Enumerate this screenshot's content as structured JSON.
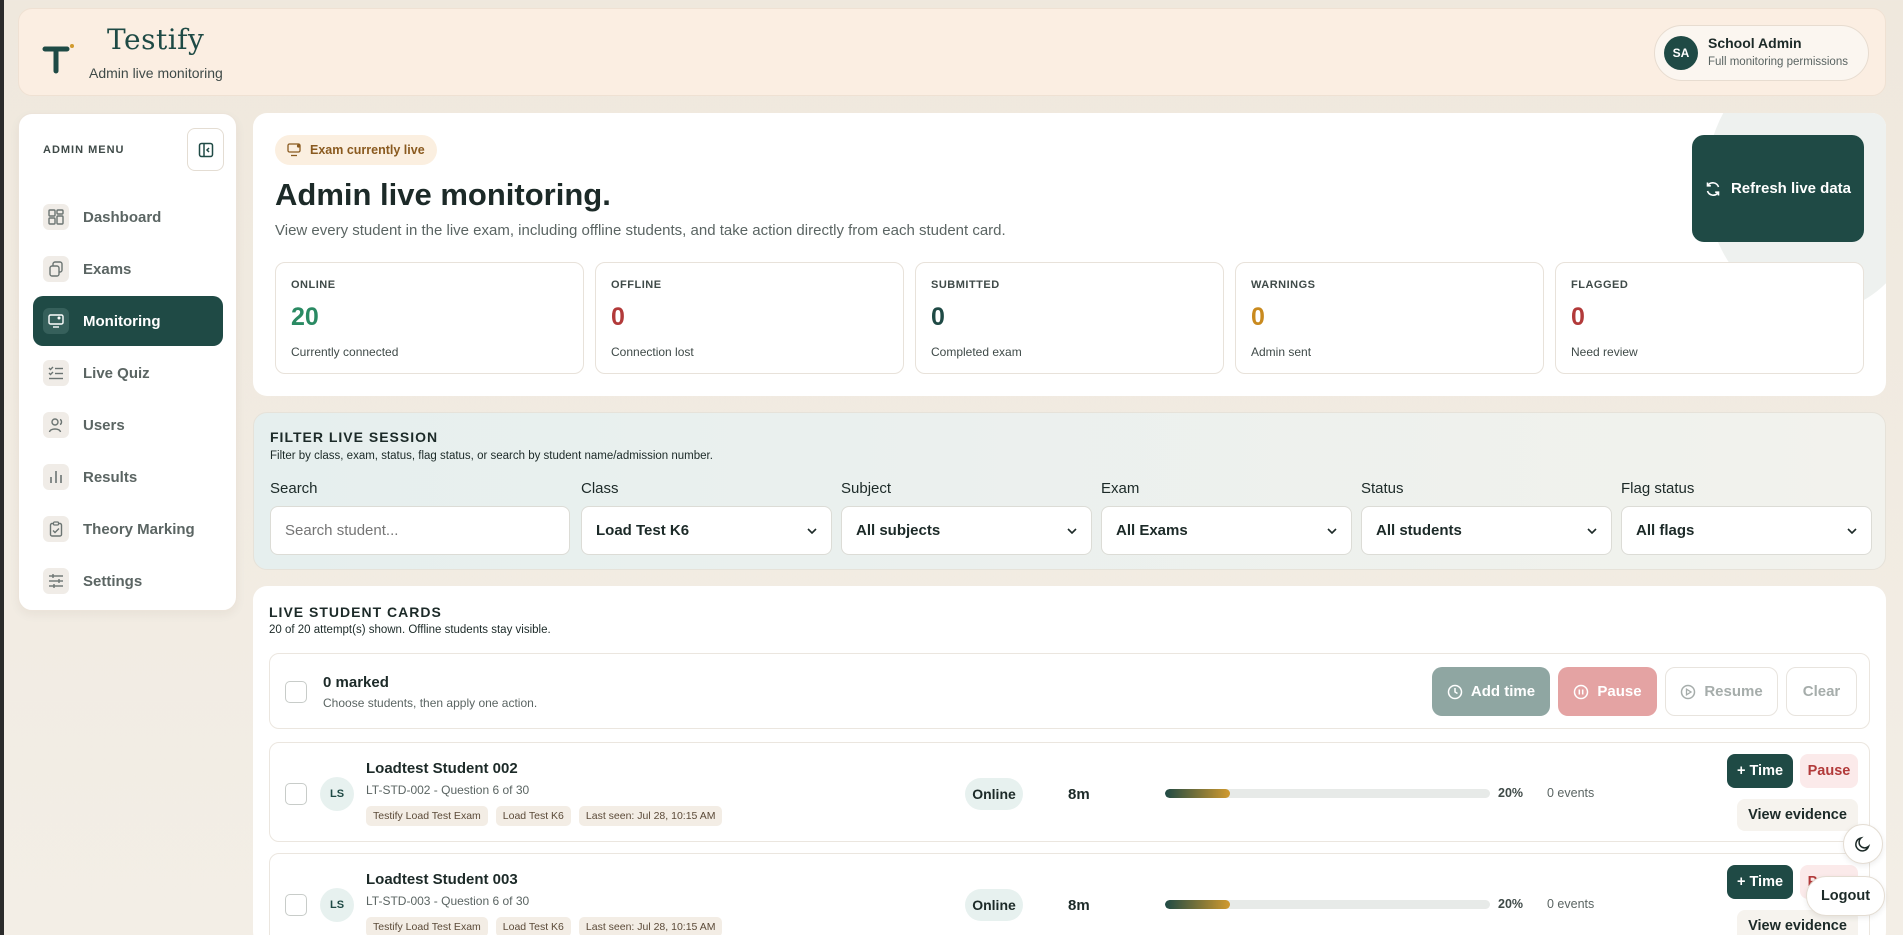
{
  "app": {
    "brand": "Testify",
    "subtitle": "Admin live monitoring",
    "logo_letter": "T"
  },
  "user": {
    "initials": "SA",
    "name": "School Admin",
    "role": "Full monitoring permissions"
  },
  "sidebar": {
    "title": "ADMIN MENU",
    "items": [
      {
        "label": "Dashboard",
        "icon": "dashboard-icon"
      },
      {
        "label": "Exams",
        "icon": "exams-icon"
      },
      {
        "label": "Monitoring",
        "icon": "monitor-icon",
        "active": true
      },
      {
        "label": "Live Quiz",
        "icon": "checklist-icon"
      },
      {
        "label": "Users",
        "icon": "users-icon"
      },
      {
        "label": "Results",
        "icon": "bar-chart-icon"
      },
      {
        "label": "Theory Marking",
        "icon": "clipboard-icon"
      },
      {
        "label": "Settings",
        "icon": "sliders-icon"
      }
    ]
  },
  "hero": {
    "badge": "Exam currently live",
    "title": "Admin live monitoring.",
    "description": "View every student in the live exam, including offline students, and take action directly from each student card.",
    "refresh_label": "Refresh live data",
    "stats": [
      {
        "label": "ONLINE",
        "value": "20",
        "sub": "Currently connected",
        "color": "#2a8a63"
      },
      {
        "label": "OFFLINE",
        "value": "0",
        "sub": "Connection lost",
        "color": "#b23a3a"
      },
      {
        "label": "SUBMITTED",
        "value": "0",
        "sub": "Completed exam",
        "color": "#1f4a45"
      },
      {
        "label": "WARNINGS",
        "value": "0",
        "sub": "Admin sent",
        "color": "#c98a1f"
      },
      {
        "label": "FLAGGED",
        "value": "0",
        "sub": "Need review",
        "color": "#b23a3a"
      }
    ]
  },
  "filters": {
    "title": "FILTER LIVE SESSION",
    "subtitle": "Filter by class, exam, status, flag status, or search by student name/admission number.",
    "search_label": "Search",
    "search_placeholder": "Search student...",
    "fields": [
      {
        "label": "Class",
        "value": "Load Test K6"
      },
      {
        "label": "Subject",
        "value": "All subjects"
      },
      {
        "label": "Exam",
        "value": "All Exams"
      },
      {
        "label": "Status",
        "value": "All students"
      },
      {
        "label": "Flag status",
        "value": "All flags"
      }
    ]
  },
  "cards": {
    "title": "LIVE STUDENT CARDS",
    "subtitle": "20 of 20 attempt(s) shown. Offline students stay visible.",
    "bulk": {
      "count": "0 marked",
      "hint": "Choose students, then apply one action.",
      "add_time": "Add time",
      "pause": "Pause",
      "resume": "Resume",
      "clear": "Clear"
    },
    "students": [
      {
        "initials": "LS",
        "name": "Loadtest Student 002",
        "meta": "LT-STD-002 - Question 6 of 30",
        "tags": [
          "Testify Load Test Exam",
          "Load Test K6",
          "Last seen: Jul 28, 10:15 AM"
        ],
        "status": "Online",
        "time": "8m",
        "progress": 20,
        "progress_label": "20%",
        "events": "0 events",
        "time_btn": "+ Time",
        "pause_btn": "Pause",
        "evidence_btn": "View evidence"
      },
      {
        "initials": "LS",
        "name": "Loadtest Student 003",
        "meta": "LT-STD-003 - Question 6 of 30",
        "tags": [
          "Testify Load Test Exam",
          "Load Test K6",
          "Last seen: Jul 28, 10:15 AM"
        ],
        "status": "Online",
        "time": "8m",
        "progress": 20,
        "progress_label": "20%",
        "events": "0 events",
        "time_btn": "+ Time",
        "pause_btn": "Pause",
        "evidence_btn": "View evidence"
      }
    ]
  },
  "floating": {
    "theme_icon": "moon-icon",
    "logout": "Logout"
  },
  "colors": {
    "primary": "#1f4a45",
    "danger": "#b23a3a",
    "warning": "#c98a1f",
    "success": "#2a8a63"
  }
}
